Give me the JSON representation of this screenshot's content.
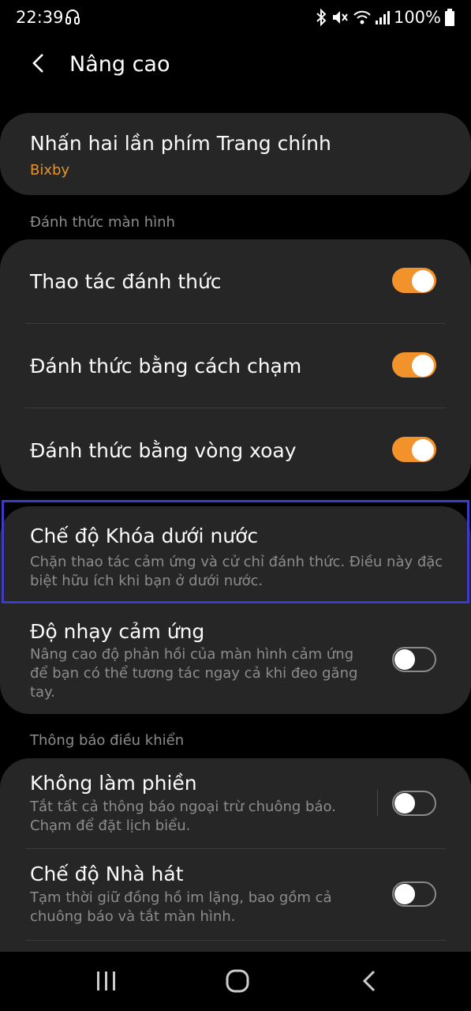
{
  "status_bar": {
    "time": "22:39",
    "battery": "100%",
    "icons": [
      "headset-icon",
      "bluetooth-icon",
      "mute-icon",
      "wifi-icon",
      "signal-icon",
      "battery-icon"
    ]
  },
  "header": {
    "title": "Nâng cao",
    "back_icon": "back-arrow-icon"
  },
  "double_press": {
    "title": "Nhấn hai lần phím Trang chính",
    "value": "Bixby"
  },
  "wake_section": {
    "label": "Đánh thức màn hình",
    "items": [
      {
        "title": "Thao tác đánh thức",
        "on": true
      },
      {
        "title": "Đánh thức bằng cách chạm",
        "on": true
      },
      {
        "title": "Đánh thức bằng vòng xoay",
        "on": true
      }
    ]
  },
  "underwater": {
    "title": "Chế độ Khóa dưới nước",
    "subtitle": "Chặn thao tác cảm ứng và cử chỉ đánh thức. Điều này đặc biệt hữu ích khi bạn ở dưới nước."
  },
  "touch_sensitivity": {
    "title": "Độ nhạy cảm ứng",
    "subtitle": "Nâng cao độ phản hồi của màn hình cảm ứng để bạn có thể tương tác ngay cả khi đeo găng tay.",
    "on": false
  },
  "notify_section": {
    "label": "Thông báo điều khiển",
    "items": [
      {
        "title": "Không làm phiền",
        "subtitle": "Tắt tất cả thông báo ngoại trừ chuông báo. Chạm để đặt lịch biểu.",
        "on": false
      },
      {
        "title": "Chế độ Nhà hát",
        "subtitle": "Tạm thời giữ đồng hồ im lặng, bao gồm cả chuông báo và tắt màn hình.",
        "on": false
      }
    ]
  },
  "nav_bar": {
    "buttons": [
      "recent-apps-icon",
      "home-icon",
      "back-icon"
    ]
  },
  "colors": {
    "accent": "#f2922a",
    "card": "#262626",
    "highlight": "#3c3cc7"
  }
}
